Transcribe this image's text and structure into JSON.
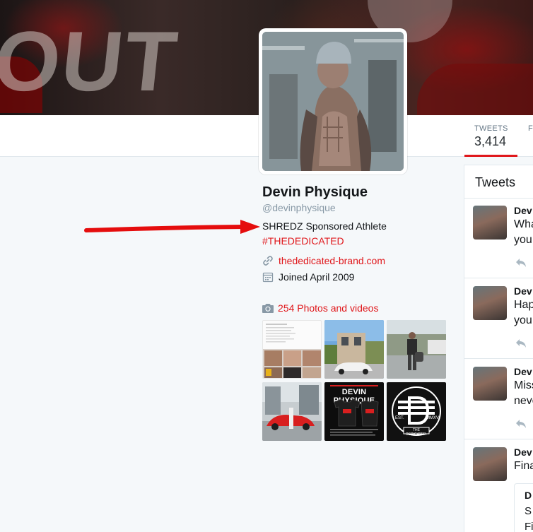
{
  "banner": {
    "text": "OUT"
  },
  "nav": {
    "tweets_label": "TWEETS",
    "tweets_count": "3,414",
    "next_label": "F"
  },
  "profile": {
    "name": "Devin Physique",
    "handle": "@devinphysique",
    "bio": "SHREDZ Sponsored Athlete",
    "hashtag": "#THEDEDICATED",
    "url": "thededicated-brand.com",
    "joined": "Joined April 2009",
    "photos_link": "254 Photos and videos"
  },
  "photo_tiles": [
    {
      "text": ""
    },
    {
      "text": ""
    },
    {
      "text": ""
    },
    {
      "text": ""
    },
    {
      "text_top": "DEVIN PHYSIQUE"
    },
    {
      "text_est": "EST.",
      "text_mmxv": "MMXV",
      "text_brand": "THE DEDICATED."
    }
  ],
  "tweets_panel": {
    "heading": "Tweets",
    "items": [
      {
        "name": "Dev",
        "line1": "Wha",
        "line2": "you"
      },
      {
        "name": "Dev",
        "line1": "Hap",
        "line2": "you"
      },
      {
        "name": "Dev",
        "line1": "Miss",
        "line2": "neve"
      },
      {
        "name": "Dev",
        "line1": "Fina",
        "line2": ""
      }
    ],
    "quote_lines": [
      "D",
      "S",
      "Fi"
    ]
  },
  "colors": {
    "accent": "#e0171b",
    "text": "#14171a",
    "muted": "#8899a6",
    "background": "#f5f8fa"
  },
  "icons": [
    "link-icon",
    "calendar-icon",
    "camera-icon",
    "reply-icon",
    "red-arrow-annotation"
  ]
}
